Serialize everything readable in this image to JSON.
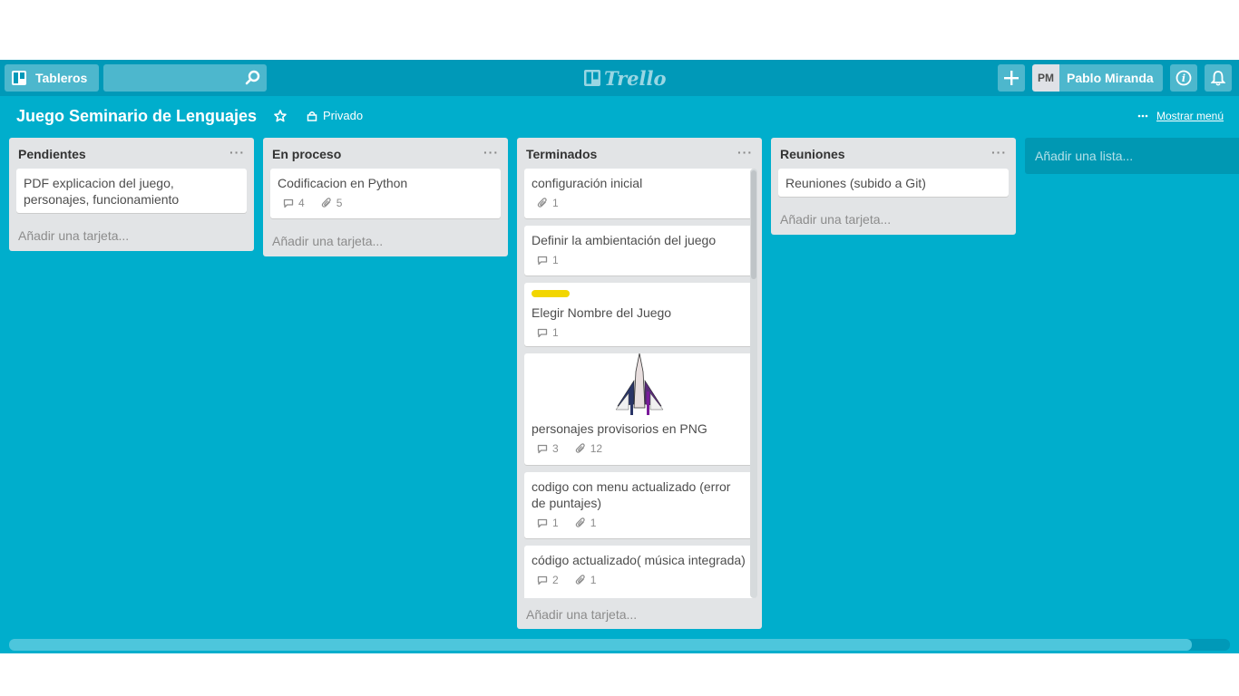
{
  "header": {
    "boards_label": "Tableros",
    "search_placeholder": "",
    "logo_text": "Trello",
    "user_initials": "PM",
    "user_name": "Pablo Miranda"
  },
  "board": {
    "title": "Juego Seminario de Lenguajes",
    "privacy": "Privado",
    "show_menu": "Mostrar menú",
    "add_list": "Añadir una lista..."
  },
  "lists": [
    {
      "title": "Pendientes",
      "menu": "···",
      "add_card": "Añadir una tarjeta...",
      "cards": [
        {
          "title": "PDF explicacion del juego, personajes, funcionamiento"
        }
      ]
    },
    {
      "title": "En proceso",
      "menu": "···",
      "add_card": "Añadir una tarjeta...",
      "cards": [
        {
          "title": "Codificacion en Python",
          "comments": "4",
          "attachments": "5"
        }
      ]
    },
    {
      "title": "Terminados",
      "menu": "···",
      "add_card": "Añadir una tarjeta...",
      "cards": [
        {
          "title": "configuración inicial",
          "attachments": "1"
        },
        {
          "title": "Definir la ambientación del juego",
          "comments": "1"
        },
        {
          "title": "Elegir Nombre del Juego",
          "comments": "1",
          "label_color": "#f2d600"
        },
        {
          "title": "personajes provisorios en PNG",
          "comments": "3",
          "attachments": "12",
          "cover": "spaceship-image"
        },
        {
          "title": "codigo con menu actualizado (error de puntajes)",
          "comments": "1",
          "attachments": "1"
        },
        {
          "title": "código actualizado( música integrada)",
          "comments": "2",
          "attachments": "1"
        }
      ]
    },
    {
      "title": "Reuniones",
      "menu": "···",
      "add_card": "Añadir una tarjeta...",
      "cards": [
        {
          "title": "Reuniones (subido a Git)"
        }
      ]
    }
  ],
  "colors": {
    "board_bg": "#00aecc",
    "header_bg": "#0099b8",
    "list_bg": "#e2e4e6",
    "label_yellow": "#f2d600"
  }
}
